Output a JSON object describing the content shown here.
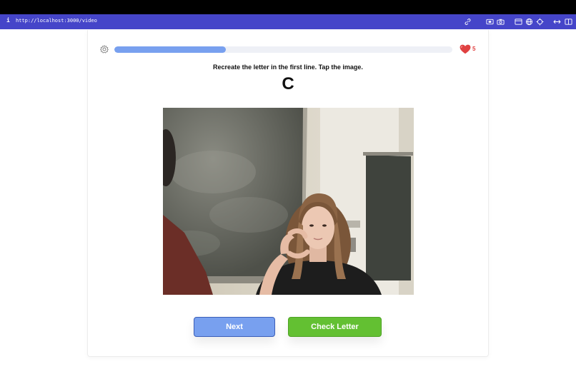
{
  "browser": {
    "info_glyph": "i",
    "url": "http://localhost:3000/video",
    "toolbar_icons": [
      "link-icon",
      "screenshot-icon",
      "camera-icon",
      "window-icon",
      "globe-icon",
      "crosshair-icon",
      "resize-icon",
      "sidebar-icon"
    ]
  },
  "lesson": {
    "progress": 0.33,
    "lives": "5",
    "instruction": "Recreate the letter in the first line. Tap the image.",
    "letter": "C"
  },
  "actions": {
    "next_label": "Next",
    "check_label": "Check Letter"
  },
  "colors": {
    "url_bar": "#4545c9",
    "progress_fill": "#78a0ef",
    "next_button": "#78a0ef",
    "check_button": "#63c032",
    "heart": "#e04141"
  }
}
